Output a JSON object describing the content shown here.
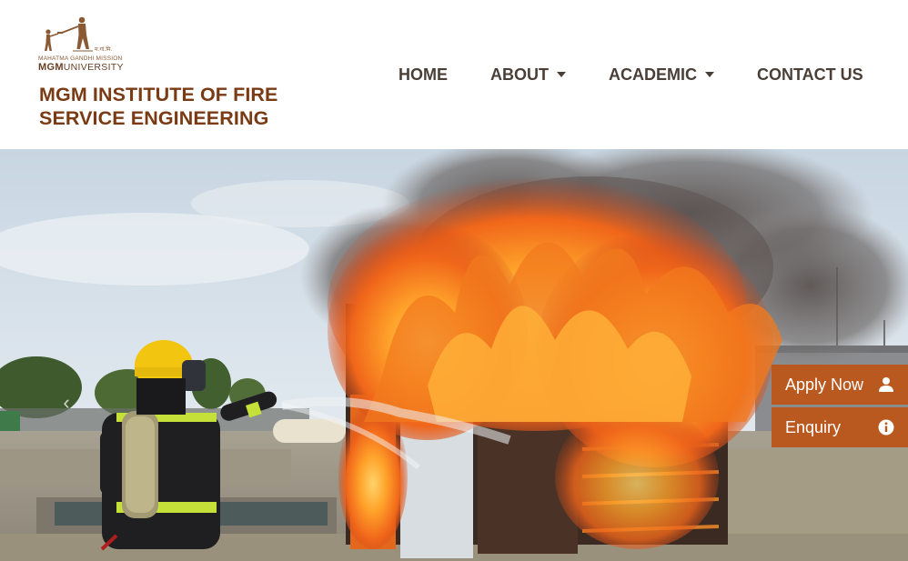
{
  "logo": {
    "hindi_text": "म.गां.मि.",
    "sub_text": "MAHATMA GANDHI MISSION",
    "mgm_text": "MGM",
    "university_text": "UNIVERSITY"
  },
  "site": {
    "title_line1": "MGM INSTITUTE OF FIRE",
    "title_line2": "SERVICE ENGINEERING"
  },
  "nav": {
    "home": "HOME",
    "about": "ABOUT",
    "academic": "ACADEMIC",
    "contact": "CONTACT US"
  },
  "hero": {
    "prev_icon": "chevron-left-icon",
    "prev_glyph": "‹"
  },
  "cta": {
    "apply_label": "Apply Now",
    "apply_icon": "user-icon",
    "enquiry_label": "Enquiry",
    "enquiry_icon": "info-icon"
  },
  "colors": {
    "brand_title": "#7a3b14",
    "nav_text": "#4a3f37",
    "cta_bg": "#b9581f"
  }
}
